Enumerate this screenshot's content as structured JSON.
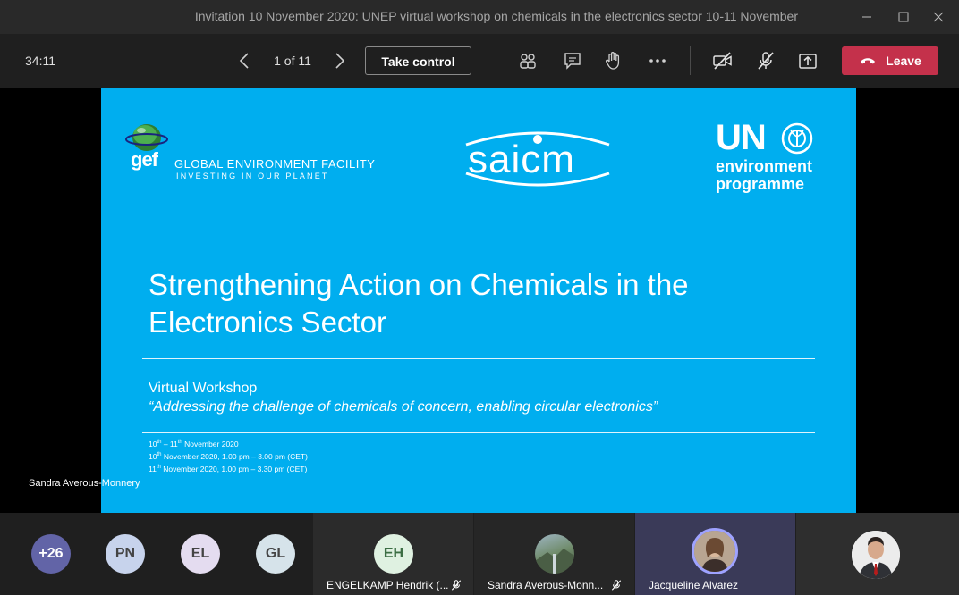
{
  "window": {
    "title": "Invitation 10 November 2020: UNEP virtual workshop on chemicals in the electronics sector 10-11 November 2020"
  },
  "toolbar": {
    "timer": "34:11",
    "page_indicator": "1 of 11",
    "take_control_label": "Take control",
    "leave_label": "Leave",
    "leave_color": "#c4314b",
    "icons": [
      "chevron-left-icon",
      "chevron-right-icon",
      "people-icon",
      "chat-icon",
      "raise-hand-icon",
      "more-icon",
      "camera-off-icon",
      "mic-off-icon",
      "share-tray-icon",
      "phone-hangup-icon"
    ]
  },
  "slide": {
    "background_color": "#00aeef",
    "gef_abbrev": "gef",
    "gef_name": "GLOBAL ENVIRONMENT FACILITY",
    "gef_tagline": "INVESTING IN OUR PLANET",
    "saicm": "saicm",
    "un_letters": "UN",
    "un_env_line1": "environment",
    "un_env_line2": "programme",
    "title_line1": "Strengthening Action on Chemicals in the",
    "title_line2": "Electronics Sector",
    "subtitle": "Virtual Workshop",
    "quote": "“Addressing the challenge of chemicals of concern, enabling circular electronics”",
    "date_range_a": "10",
    "date_range_a_sup": "th",
    "date_range_mid": " – 11",
    "date_range_b_sup": "th",
    "date_range_end": " November 2020",
    "date_line2_day": "10",
    "date_line2_sup": "th",
    "date_line2_rest": " November 2020, 1.00 pm – 3.00 pm (CET)",
    "date_line3_day": "11",
    "date_line3_sup": "th",
    "date_line3_rest": " November 2020, 1.00 pm – 3.30 pm (CET)"
  },
  "presenter_label": "Sandra Averous-Monnery",
  "participants": {
    "overflow_count": "+26",
    "initials": [
      {
        "initials": "PN",
        "color": "#c7d3ec"
      },
      {
        "initials": "EL",
        "color": "#e4dcf0"
      },
      {
        "initials": "GL",
        "color": "#d6e3ea"
      }
    ],
    "tiles": [
      {
        "initials": "EH",
        "name": "ENGELKAMP Hendrik (...",
        "muted": true,
        "avatar_color": "#dff1e1"
      },
      {
        "name": "Sandra Averous-Monn...",
        "muted": true
      },
      {
        "name": "Jacqueline Alvarez",
        "muted": false
      },
      {
        "name": "",
        "muted": false
      }
    ]
  }
}
